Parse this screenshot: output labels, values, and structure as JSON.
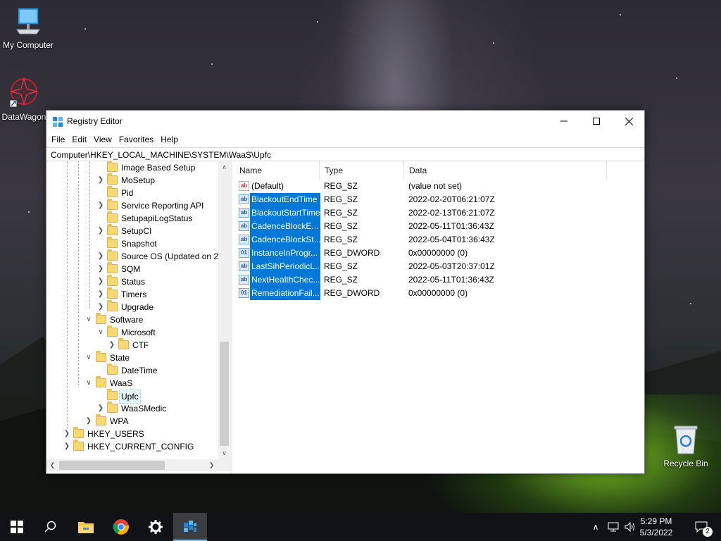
{
  "desktop": {
    "icons": [
      {
        "label": "My Computer"
      },
      {
        "label": "DataWagon"
      },
      {
        "label": "Recycle Bin"
      }
    ]
  },
  "window": {
    "title": "Registry Editor",
    "menu": [
      "File",
      "Edit",
      "View",
      "Favorites",
      "Help"
    ],
    "address": "Computer\\HKEY_LOCAL_MACHINE\\SYSTEM\\WaaS\\Upfc"
  },
  "tree": {
    "items": [
      {
        "label": "Image Based Setup"
      },
      {
        "label": "MoSetup"
      },
      {
        "label": "Pid"
      },
      {
        "label": "Service Reporting API"
      },
      {
        "label": "SetupapiLogStatus"
      },
      {
        "label": "SetupCI"
      },
      {
        "label": "Snapshot"
      },
      {
        "label": "Source OS (Updated on 2/"
      },
      {
        "label": "SQM"
      },
      {
        "label": "Status"
      },
      {
        "label": "Timers"
      },
      {
        "label": "Upgrade"
      },
      {
        "label": "Software"
      },
      {
        "label": "Microsoft"
      },
      {
        "label": "CTF"
      },
      {
        "label": "State"
      },
      {
        "label": "DateTime"
      },
      {
        "label": "WaaS"
      },
      {
        "label": "Upfc"
      },
      {
        "label": "WaaSMedic"
      },
      {
        "label": "WPA"
      },
      {
        "label": "HKEY_USERS"
      },
      {
        "label": "HKEY_CURRENT_CONFIG"
      }
    ]
  },
  "values": {
    "columns": {
      "name": "Name",
      "type": "Type",
      "data": "Data"
    },
    "rows": [
      {
        "name": "(Default)",
        "type": "REG_SZ",
        "data": "(value not set)"
      },
      {
        "name": "BlackoutEndTime",
        "type": "REG_SZ",
        "data": "2022-02-20T06:21:07Z"
      },
      {
        "name": "BlackoutStartTime",
        "type": "REG_SZ",
        "data": "2022-02-13T06:21:07Z"
      },
      {
        "name": "CadenceBlockE...",
        "type": "REG_SZ",
        "data": "2022-05-11T01:36:43Z"
      },
      {
        "name": "CadenceBlockSt...",
        "type": "REG_SZ",
        "data": "2022-05-04T01:36:43Z"
      },
      {
        "name": "InstanceInProgr...",
        "type": "REG_DWORD",
        "data": "0x00000000 (0)"
      },
      {
        "name": "LastSihPeriodicL...",
        "type": "REG_SZ",
        "data": "2022-05-03T20:37:01Z"
      },
      {
        "name": "NextHealthChec...",
        "type": "REG_SZ",
        "data": "2022-05-11T01:36:43Z"
      },
      {
        "name": "RemediationFail...",
        "type": "REG_DWORD",
        "data": "0x00000000 (0)"
      }
    ]
  },
  "taskbar": {
    "time": "5:29 PM",
    "date": "5/3/2022",
    "notification_count": "2"
  },
  "colors": {
    "selection": "#0078d7",
    "taskbar": "#101215"
  }
}
